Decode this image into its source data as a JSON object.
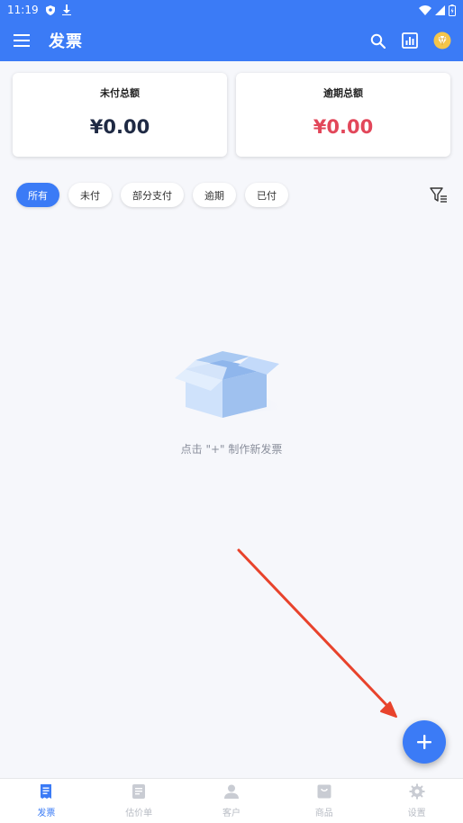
{
  "status_bar": {
    "time": "11:19"
  },
  "app_bar": {
    "title": "发票"
  },
  "summary": {
    "unpaid_label": "未付总额",
    "unpaid_amount": "¥0.00",
    "overdue_label": "逾期总额",
    "overdue_amount": "¥0.00"
  },
  "filters": [
    {
      "label": "所有",
      "active": true
    },
    {
      "label": "未付",
      "active": false
    },
    {
      "label": "部分支付",
      "active": false
    },
    {
      "label": "逾期",
      "active": false
    },
    {
      "label": "已付",
      "active": false
    }
  ],
  "empty_state": {
    "hint": "点击 \"+\" 制作新发票"
  },
  "bottom_nav": [
    {
      "label": "发票",
      "icon": "invoice-icon",
      "active": true
    },
    {
      "label": "估价单",
      "icon": "estimate-icon",
      "active": false
    },
    {
      "label": "客户",
      "icon": "client-icon",
      "active": false
    },
    {
      "label": "商品",
      "icon": "product-icon",
      "active": false
    },
    {
      "label": "设置",
      "icon": "settings-icon",
      "active": false
    }
  ],
  "colors": {
    "primary": "#3b7bf6",
    "unpaid_amount": "#1f2a44",
    "overdue_amount": "#e2475a",
    "arrow": "#e8432c"
  }
}
